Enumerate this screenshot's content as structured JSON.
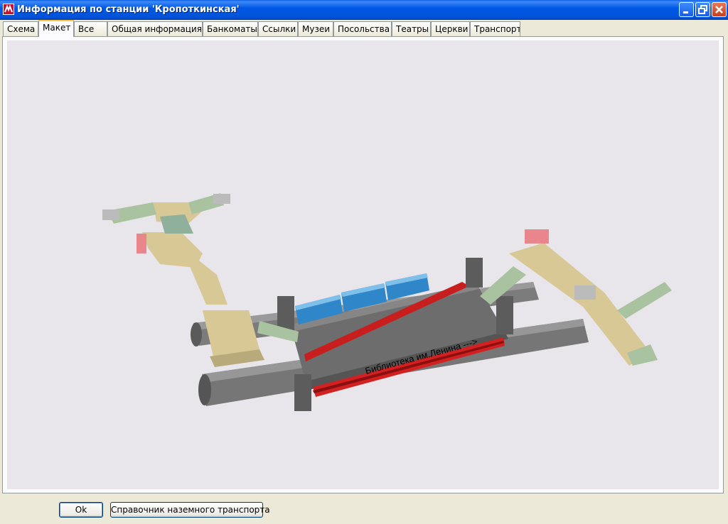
{
  "window": {
    "title": "Информация по станции 'Кропоткинская'"
  },
  "tabs": [
    {
      "label": "Схема"
    },
    {
      "label": "Макет"
    },
    {
      "label": "Все"
    },
    {
      "label": "Общая информация"
    },
    {
      "label": "Банкоматы"
    },
    {
      "label": "Ссылки"
    },
    {
      "label": "Музеи"
    },
    {
      "label": "Посольства"
    },
    {
      "label": "Театры"
    },
    {
      "label": "Церкви"
    },
    {
      "label": "Транспорт"
    }
  ],
  "active_tab": "Макет",
  "model": {
    "direction_label": "Библиотека им.Ленина --->"
  },
  "buttons": {
    "ok": "Ok",
    "transport": "Справочник наземного транспорта"
  },
  "colors": {
    "titlebar": "#0054e3",
    "platform": "#6f6f6f",
    "track": "#d32020",
    "train": "#2f86c8",
    "vestibule": "#d8c896",
    "escalator": "#a9c2a0",
    "tunnel": "#777777"
  }
}
